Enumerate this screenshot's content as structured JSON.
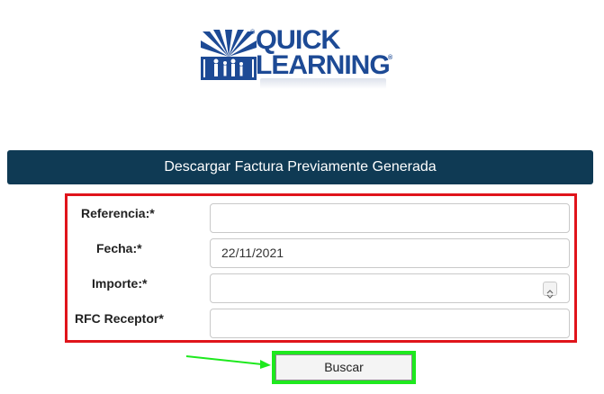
{
  "logo": {
    "line1": "QUICK",
    "line2": "LEARNING",
    "registered": "®",
    "brand_color": "#1d4a95"
  },
  "header": {
    "title": "Descargar Factura Previamente Generada",
    "background": "#0f3a54"
  },
  "form": {
    "fields": [
      {
        "label": "Referencia:*",
        "value": ""
      },
      {
        "label": "Fecha:*",
        "value": "22/11/2021"
      },
      {
        "label": "Importe:*",
        "value": ""
      },
      {
        "label": "RFC Receptor*",
        "value": ""
      }
    ]
  },
  "actions": {
    "search_label": "Buscar"
  },
  "annotations": {
    "red_box_color": "#e0141b",
    "green_box_color": "#1ee91e"
  }
}
